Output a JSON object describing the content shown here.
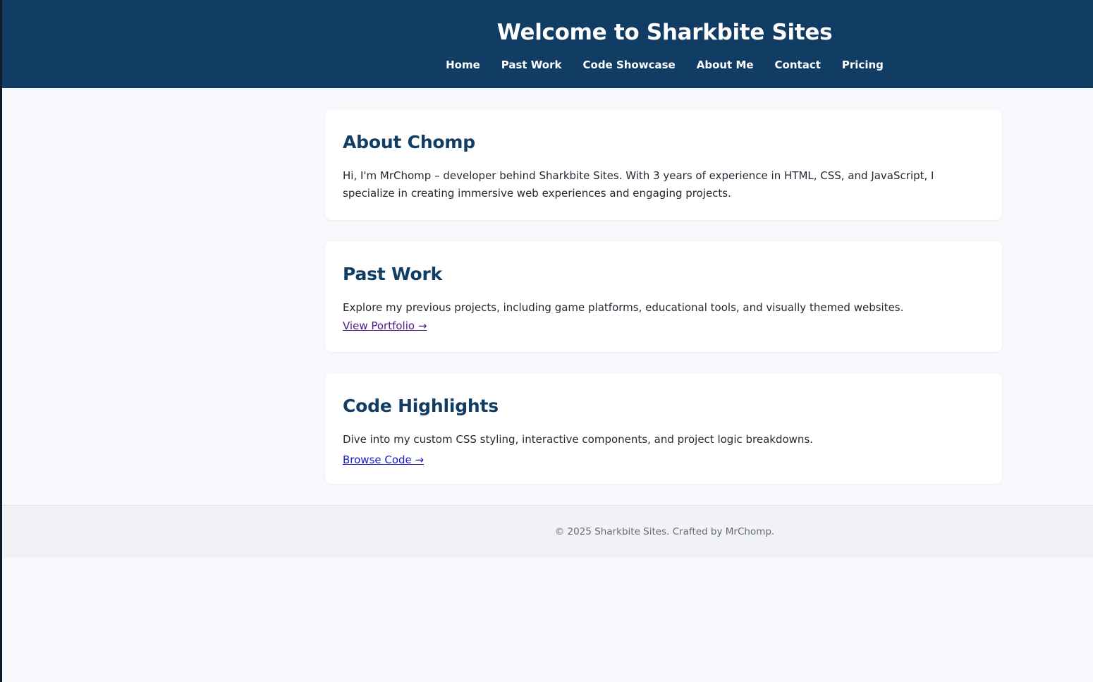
{
  "header": {
    "title": "Welcome to Sharkbite Sites",
    "nav": [
      {
        "label": "Home"
      },
      {
        "label": "Past Work"
      },
      {
        "label": "Code Showcase"
      },
      {
        "label": "About Me"
      },
      {
        "label": "Contact"
      },
      {
        "label": "Pricing"
      }
    ]
  },
  "sections": [
    {
      "heading": "About Chomp",
      "body": "Hi, I'm MrChomp – developer behind Sharkbite Sites. With 3 years of experience in HTML, CSS, and JavaScript, I specialize in creating immersive web experiences and engaging projects."
    },
    {
      "heading": "Past Work",
      "body": "Explore my previous projects, including game platforms, educational tools, and visually themed websites.",
      "link": "View Portfolio →"
    },
    {
      "heading": "Code Highlights",
      "body": "Dive into my custom CSS styling, interactive components, and project logic breakdowns.",
      "link": "Browse Code →"
    }
  ],
  "footer": {
    "text": "© 2025 Sharkbite Sites. Crafted by MrChomp."
  },
  "colors": {
    "header_bg": "#113d64",
    "heading": "#113d64",
    "page_bg": "#f7f9fc",
    "visited_link": "#4b1c80",
    "link": "#1a1acc"
  }
}
